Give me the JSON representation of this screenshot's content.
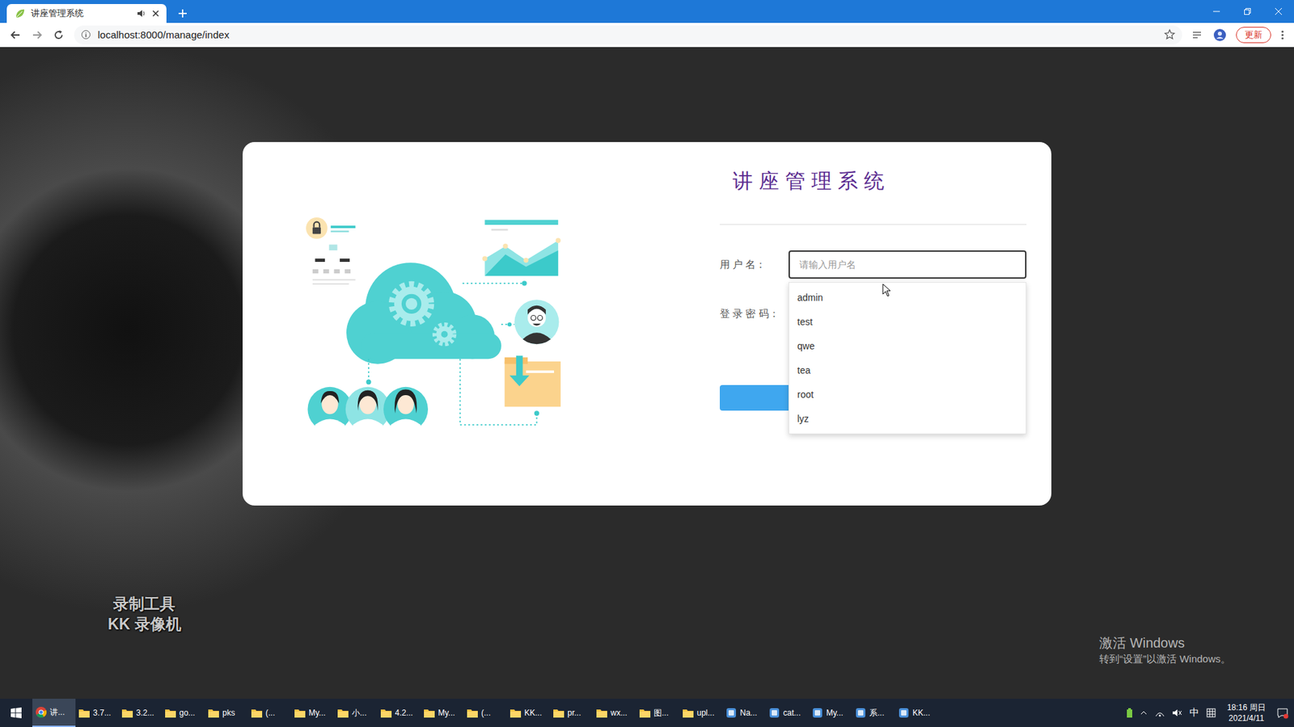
{
  "browser": {
    "tab_title": "讲座管理系统",
    "audio_playing": true,
    "address": "localhost:8000/manage/index",
    "update_button": "更新"
  },
  "login": {
    "title": "讲座管理系统",
    "username": {
      "label": "用 户 名：",
      "placeholder": "请输入用户名",
      "focused": true
    },
    "password": {
      "label": "登 录 密 码："
    },
    "autocomplete": [
      {
        "label": "admin",
        "selected": false
      },
      {
        "label": "test",
        "selected": false
      },
      {
        "label": "qwe",
        "selected": false
      },
      {
        "label": "tea",
        "selected": false
      },
      {
        "label": "root",
        "selected": false
      },
      {
        "label": "lyz",
        "selected": false
      }
    ]
  },
  "watermarks": {
    "recorder": [
      "录制工具",
      "KK 录像机"
    ],
    "activation": [
      "激活 Windows",
      "转到“设置”以激活 Windows。"
    ]
  },
  "taskbar": {
    "items": [
      {
        "label": "讲...",
        "kind": "browser",
        "active": true
      },
      {
        "label": "3.7...",
        "kind": "folder",
        "active": false
      },
      {
        "label": "3.2...",
        "kind": "folder",
        "active": false
      },
      {
        "label": "go...",
        "kind": "folder",
        "active": false
      },
      {
        "label": "pks",
        "kind": "folder",
        "active": false
      },
      {
        "label": "(...",
        "kind": "folder",
        "active": false
      },
      {
        "label": "My...",
        "kind": "folder",
        "active": false
      },
      {
        "label": "小...",
        "kind": "folder",
        "active": false
      },
      {
        "label": "4.2...",
        "kind": "folder",
        "active": false
      },
      {
        "label": "My...",
        "kind": "folder",
        "active": false
      },
      {
        "label": "(...",
        "kind": "folder",
        "active": false
      },
      {
        "label": "KK...",
        "kind": "folder",
        "active": false
      },
      {
        "label": "pr...",
        "kind": "folder",
        "active": false
      },
      {
        "label": "wx...",
        "kind": "folder",
        "active": false
      },
      {
        "label": "图...",
        "kind": "folder",
        "active": false
      },
      {
        "label": "upl...",
        "kind": "folder",
        "active": false
      },
      {
        "label": "Na...",
        "kind": "app",
        "active": false
      },
      {
        "label": "cat...",
        "kind": "app",
        "active": false
      },
      {
        "label": "My...",
        "kind": "app",
        "active": false
      },
      {
        "label": "系...",
        "kind": "app",
        "active": false
      },
      {
        "label": "KK...",
        "kind": "app",
        "active": false
      }
    ],
    "ime": "中",
    "clock": {
      "time": "18:16 周日",
      "date": "2021/4/11"
    }
  }
}
